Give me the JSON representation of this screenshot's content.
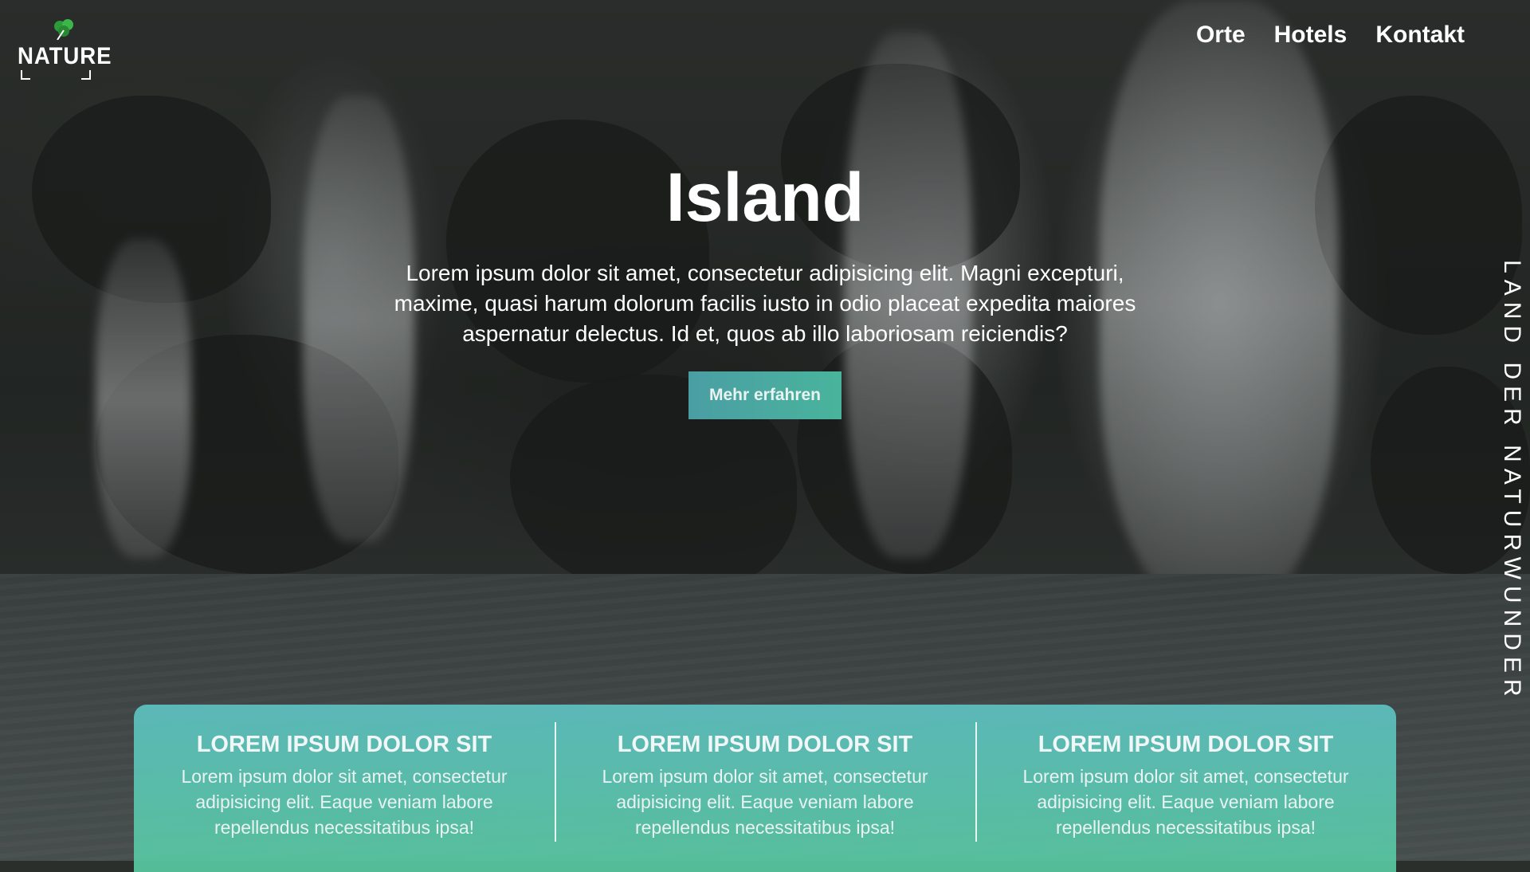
{
  "brand": {
    "logo_text": "NATURE",
    "logo_icon": "leaf-icon"
  },
  "nav": {
    "items": [
      "Orte",
      "Hotels",
      "Kontakt"
    ]
  },
  "hero": {
    "title": "Island",
    "text": "Lorem ipsum dolor sit amet, consectetur adipisicing elit. Magni excepturi, maxime, quasi harum dolorum facilis iusto in odio placeat expedita maiores aspernatur delectus. Id et, quos ab illo laboriosam reiciendis?",
    "cta_label": "Mehr erfahren"
  },
  "side_text": "LAND DER NATURWUNDER",
  "features": [
    {
      "title": "LOREM IPSUM DOLOR SIT",
      "text": "Lorem ipsum dolor sit amet, consectetur adipisicing elit. Eaque veniam labore repellendus necessitatibus ipsa!"
    },
    {
      "title": "LOREM IPSUM DOLOR SIT",
      "text": "Lorem ipsum dolor sit amet, consectetur adipisicing elit. Eaque veniam labore repellendus necessitatibus ipsa!"
    },
    {
      "title": "LOREM IPSUM DOLOR SIT",
      "text": "Lorem ipsum dolor sit amet, consectetur adipisicing elit. Eaque veniam labore repellendus necessitatibus ipsa!"
    }
  ],
  "colors": {
    "accent_start": "#4a9ea3",
    "accent_end": "#49b49c",
    "panel": "#5ec4c4"
  }
}
